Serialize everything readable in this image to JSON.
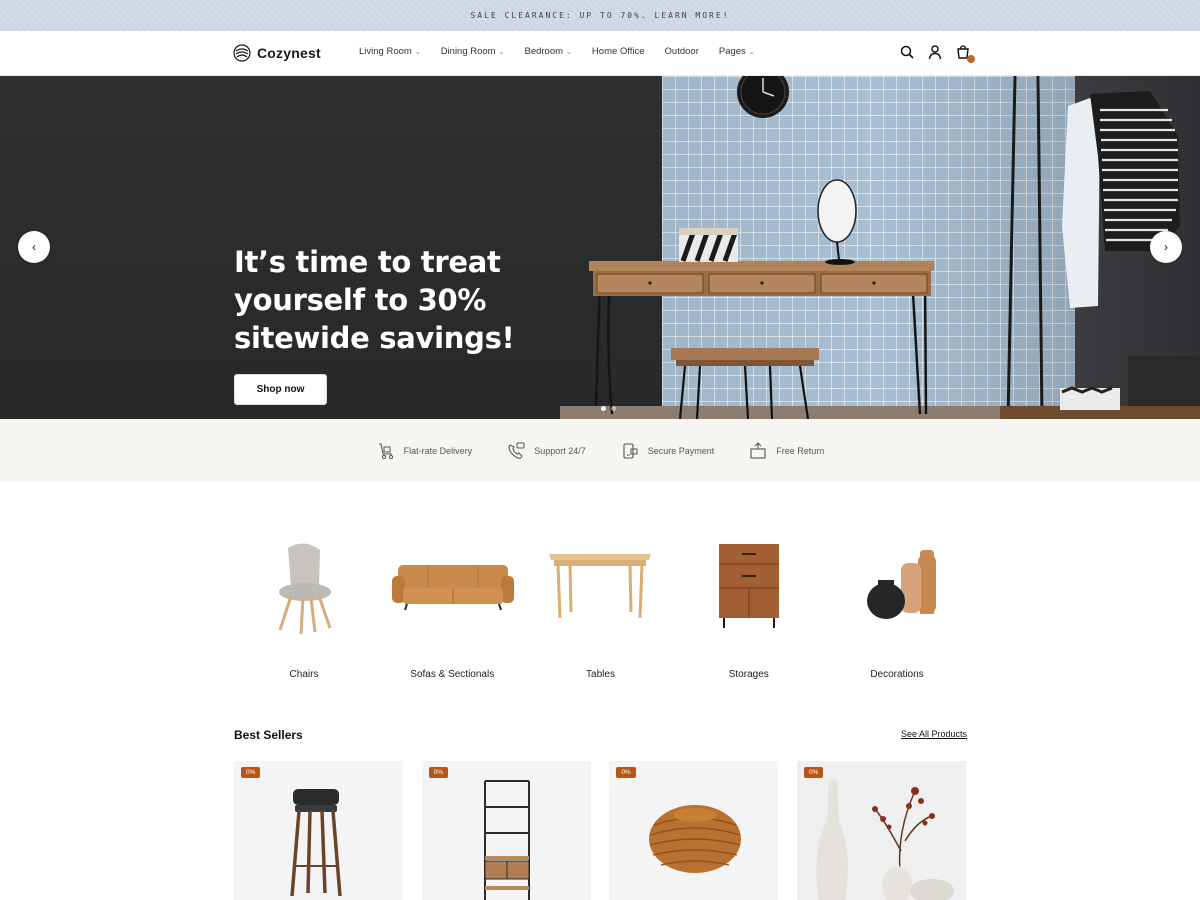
{
  "announcement": {
    "text": "SALE CLEARANCE: UP TO 70%. LEARN MORE!"
  },
  "header": {
    "brand": "Cozynest",
    "nav": [
      {
        "label": "Living Room",
        "has_dropdown": true
      },
      {
        "label": "Dining Room",
        "has_dropdown": true
      },
      {
        "label": "Bedroom",
        "has_dropdown": true
      },
      {
        "label": "Home Office",
        "has_dropdown": false
      },
      {
        "label": "Outdoor",
        "has_dropdown": false
      },
      {
        "label": "Pages",
        "has_dropdown": true
      }
    ],
    "dropdown_glyph": "⌄",
    "icons": [
      "search-icon",
      "user-icon",
      "cart-icon"
    ],
    "accent": "#c0661e"
  },
  "hero": {
    "title": "It’s time to treat yourself to 30% sitewide savings!",
    "cta": "Shop now",
    "prev_glyph": "‹",
    "next_glyph": "›",
    "slides": 2,
    "active_slide": 1
  },
  "features": [
    {
      "label": "Flat-rate Delivery",
      "icon": "delivery-icon"
    },
    {
      "label": "Support 24/7",
      "icon": "support-icon"
    },
    {
      "label": "Secure Payment",
      "icon": "secure-payment-icon"
    },
    {
      "label": "Free Return",
      "icon": "return-icon"
    }
  ],
  "categories": [
    {
      "label": "Chairs"
    },
    {
      "label": "Sofas & Sectionals"
    },
    {
      "label": "Tables"
    },
    {
      "label": "Storages"
    },
    {
      "label": "Decorations"
    }
  ],
  "best_sellers": {
    "title": "Best Sellers",
    "see_all": "See All Products",
    "badge_color": "#b8561a",
    "products": [
      {
        "badge": "0%"
      },
      {
        "badge": "0%"
      },
      {
        "badge": "0%"
      },
      {
        "badge": "0%"
      }
    ]
  }
}
